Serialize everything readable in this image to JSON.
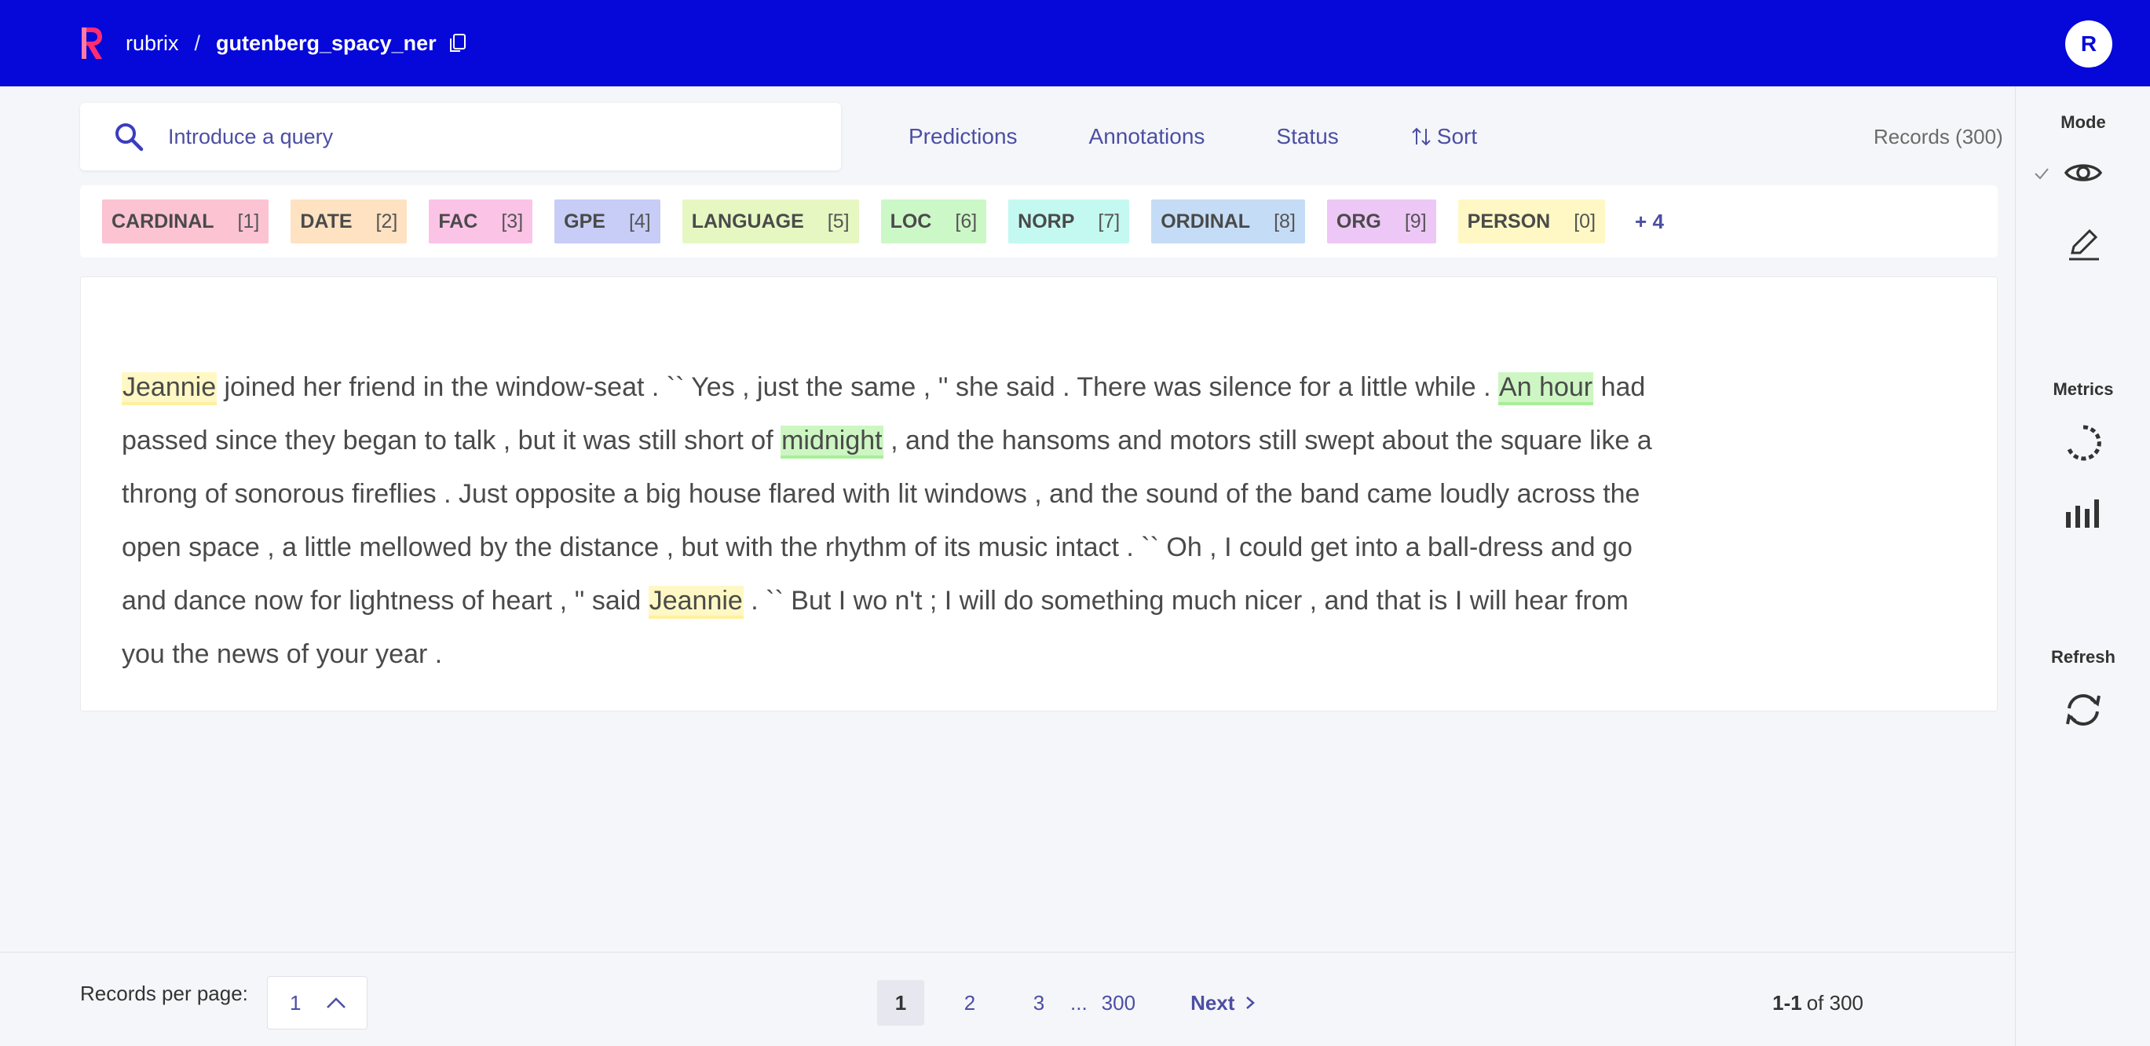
{
  "header": {
    "workspace": "rubrix",
    "separator": "/",
    "dataset": "gutenberg_spacy_ner",
    "avatar_initial": "R"
  },
  "search": {
    "placeholder": "Introduce a query",
    "value": ""
  },
  "filters": {
    "predictions": "Predictions",
    "annotations": "Annotations",
    "status": "Status",
    "sort": "Sort"
  },
  "records_count": "Records (300)",
  "labels": [
    {
      "name": "CARDINAL",
      "key": "[1]",
      "color": "#fcc3d3"
    },
    {
      "name": "DATE",
      "key": "[2]",
      "color": "#fee2c2"
    },
    {
      "name": "FAC",
      "key": "[3]",
      "color": "#fbc3e6"
    },
    {
      "name": "GPE",
      "key": "[4]",
      "color": "#c7cdf6"
    },
    {
      "name": "LANGUAGE",
      "key": "[5]",
      "color": "#e6f7c2"
    },
    {
      "name": "LOC",
      "key": "[6]",
      "color": "#ccf7c7"
    },
    {
      "name": "NORP",
      "key": "[7]",
      "color": "#c3f9f0"
    },
    {
      "name": "ORDINAL",
      "key": "[8]",
      "color": "#c5dcf6"
    },
    {
      "name": "ORG",
      "key": "[9]",
      "color": "#edc7f6"
    },
    {
      "name": "PERSON",
      "key": "[0]",
      "color": "#fff8c4"
    }
  ],
  "labels_more": "+ 4",
  "record": {
    "segments": [
      {
        "text": "Jeannie",
        "entity": "person"
      },
      {
        "text": " joined her friend in the window-seat . `` Yes , just the same , '' she said . There was silence for a little while . "
      },
      {
        "text": "An hour",
        "entity": "time"
      },
      {
        "text": " had passed since they began to talk , but it was still short of "
      },
      {
        "text": "midnight",
        "entity": "time"
      },
      {
        "text": " , and the hansoms and motors still swept about the square like a throng of sonorous fireflies . Just opposite a big house flared with lit windows , and the sound of the band came loudly across the open space , a little mellowed by the distance , but with the rhythm of its music intact . `` Oh , I could get into a ball-dress and go and dance now for lightness of heart , '' said "
      },
      {
        "text": "Jeannie",
        "entity": "person"
      },
      {
        "text": " . `` But I wo n't ; I will do something much nicer , and that is I will hear from you the news of your year ."
      }
    ]
  },
  "sidebar": {
    "mode_title": "Mode",
    "metrics_title": "Metrics",
    "refresh_title": "Refresh",
    "mode_icons": [
      "eye-icon",
      "pencil-icon"
    ],
    "metrics_icons": [
      "progress-circle-icon",
      "bar-chart-icon"
    ],
    "refresh_icon": "refresh-icon"
  },
  "footer": {
    "per_page_label": "Records per page:",
    "per_page_value": "1",
    "pages": [
      "1",
      "2",
      "3"
    ],
    "ellipsis": "...",
    "last_page": "300",
    "next_label": "Next",
    "range_bold": "1-1",
    "range_rest": "of 300"
  }
}
